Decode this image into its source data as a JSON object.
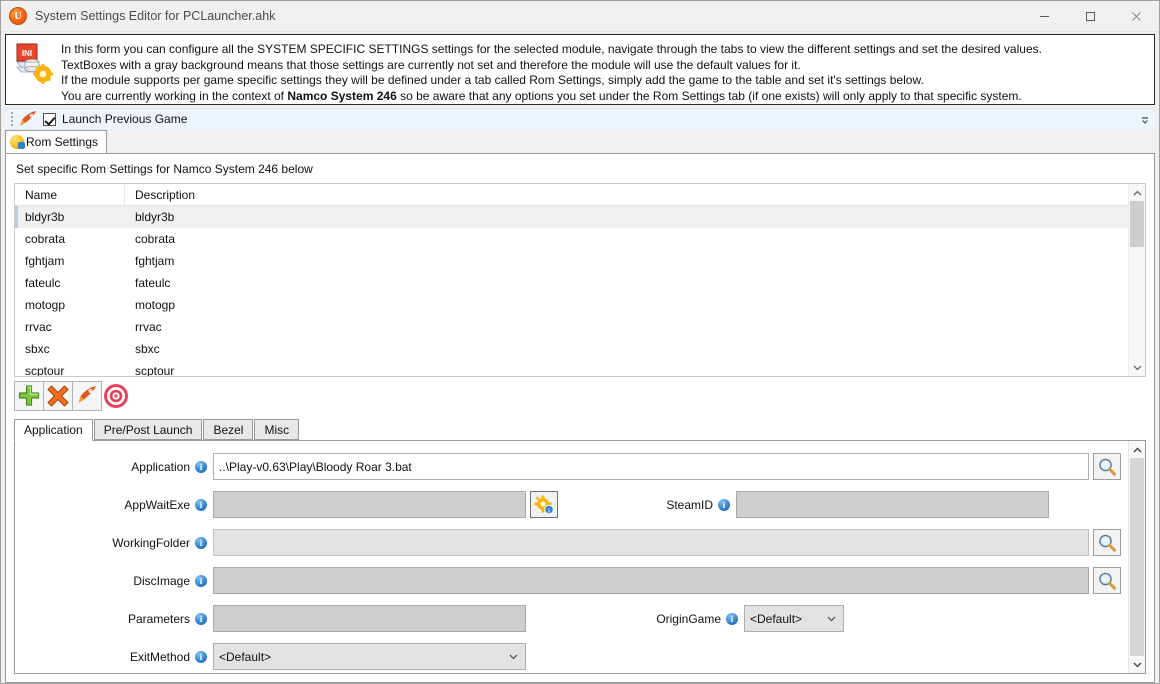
{
  "window": {
    "title": "System Settings Editor for PCLauncher.ahk",
    "icon": "autohotkey-icon",
    "controls": {
      "minimize": "—",
      "maximize": "☐",
      "close": "✕"
    }
  },
  "banner": {
    "icon": "ini-settings-icon",
    "line1": "In this form you can configure all the SYSTEM SPECIFIC SETTINGS settings for the selected module, navigate through the tabs to view the different settings and set the desired values.",
    "line2": "TextBoxes with a gray background means that those settings are currently not set and therefore the module will use the default values for it.",
    "line3": "If the module supports per game specific settings they will be defined under a tab called Rom Settings, simply add the game to the table and set it's settings below.",
    "line4_pre": "You are currently working in the context of ",
    "line4_bold": "Namco System 246",
    "line4_post": " so be aware that any options you set under the Rom Settings tab (if one exists) will only apply to that specific system."
  },
  "toolbar": {
    "rocket_icon": "rocket-icon",
    "checkbox_checked": true,
    "checkbox_label": "Launch Previous Game",
    "overflow_icon": "overflow-chevron-icon"
  },
  "top_tabs": [
    {
      "label": "Rom Settings",
      "icon": "rom-settings-icon",
      "active": true
    }
  ],
  "panel": {
    "caption": "Set specific Rom Settings for Namco System 246 below"
  },
  "listview": {
    "columns": [
      "Name",
      "Description"
    ],
    "rows": [
      {
        "name": "bldyr3b",
        "description": "bldyr3b",
        "selected": true
      },
      {
        "name": "cobrata",
        "description": "cobrata",
        "selected": false
      },
      {
        "name": "fghtjam",
        "description": "fghtjam",
        "selected": false
      },
      {
        "name": "fateulc",
        "description": "fateulc",
        "selected": false
      },
      {
        "name": "motogp",
        "description": "motogp",
        "selected": false
      },
      {
        "name": "rrvac",
        "description": "rrvac",
        "selected": false
      },
      {
        "name": "sbxc",
        "description": "sbxc",
        "selected": false
      },
      {
        "name": "scptour",
        "description": "scptour",
        "selected": false
      }
    ],
    "scrollbar": {
      "up": "⌃",
      "down": "⌄"
    }
  },
  "actions": [
    {
      "name": "add-rom-button",
      "icon": "green-plus-icon"
    },
    {
      "name": "delete-rom-button",
      "icon": "orange-x-icon"
    },
    {
      "name": "launch-rom-button",
      "icon": "rocket-icon"
    },
    {
      "name": "target-button",
      "icon": "target-bullseye-icon"
    }
  ],
  "bottom_tabs": [
    {
      "label": "Application",
      "active": true
    },
    {
      "label": "Pre/Post Launch",
      "active": false
    },
    {
      "label": "Bezel",
      "active": false
    },
    {
      "label": "Misc",
      "active": false
    }
  ],
  "form": {
    "application": {
      "label": "Application",
      "value": "..\\Play-v0.63\\Play\\Bloody Roar 3.bat",
      "enabled": true,
      "browse_icon": "magnifier-icon"
    },
    "appwaitexe": {
      "label": "AppWaitExe",
      "value": "",
      "enabled": false,
      "gear_icon": "gear-info-icon"
    },
    "steamid": {
      "label": "SteamID",
      "value": "",
      "enabled": false
    },
    "workingfolder": {
      "label": "WorkingFolder",
      "value": "",
      "enabled": false,
      "browse_icon": "magnifier-icon"
    },
    "discimage": {
      "label": "DiscImage",
      "value": "",
      "enabled": false,
      "browse_icon": "magnifier-icon"
    },
    "parameters": {
      "label": "Parameters",
      "value": "",
      "enabled": false
    },
    "origingame": {
      "label": "OriginGame",
      "value": "<Default>",
      "caret": "⌄"
    },
    "exitmethod": {
      "label": "ExitMethod",
      "value": "<Default>",
      "caret": "⌄"
    },
    "info_glyph": "i",
    "scrollbar": {
      "up": "⌃",
      "down": "⌄"
    }
  },
  "colors": {
    "accent_blue": "#2f7fd1",
    "toolbar_bg": "#eef4fb",
    "disabled_field": "#cfcfcf",
    "selected_row": "#f0f0f0"
  }
}
